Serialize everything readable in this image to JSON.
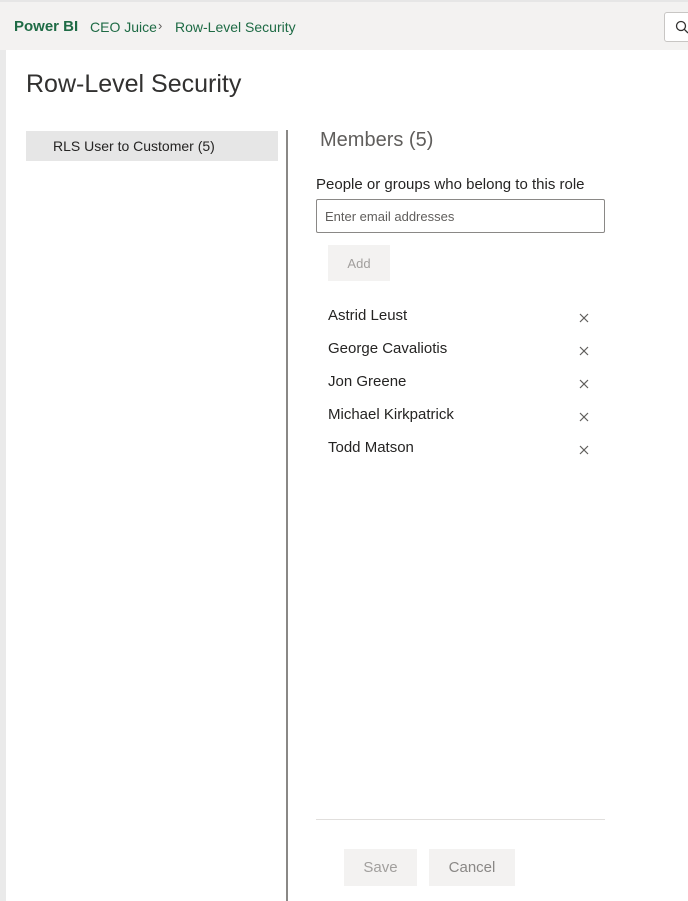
{
  "header": {
    "brand": "Power BI",
    "breadcrumb": [
      "CEO Juice",
      "Row-Level Security"
    ],
    "separator": "›"
  },
  "page": {
    "title": "Row-Level Security"
  },
  "roles": [
    {
      "label": "RLS User to Customer (5)",
      "selected": true
    }
  ],
  "members": {
    "title": "Members (5)",
    "subtitle": "People or groups who belong to this role",
    "input_placeholder": "Enter email addresses",
    "add_label": "Add",
    "list": [
      {
        "name": "Astrid Leust"
      },
      {
        "name": "George Cavaliotis"
      },
      {
        "name": "Jon Greene"
      },
      {
        "name": "Michael Kirkpatrick"
      },
      {
        "name": "Todd Matson"
      }
    ]
  },
  "footer": {
    "save_label": "Save",
    "cancel_label": "Cancel"
  },
  "colors": {
    "brand": "#1e6b45",
    "selected_item_bg": "#e6e6e6",
    "disabled_button_bg": "#f3f2f1"
  },
  "icons": {
    "search": "search-icon",
    "remove": "close-icon"
  }
}
